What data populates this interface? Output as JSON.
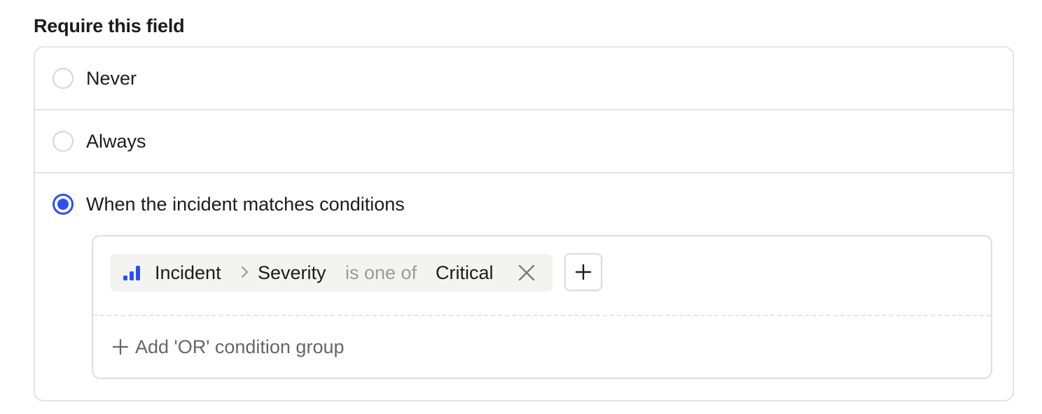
{
  "field": {
    "label": "Require this field"
  },
  "options": [
    {
      "label": "Never",
      "selected": false
    },
    {
      "label": "Always",
      "selected": false
    },
    {
      "label": "When the incident matches conditions",
      "selected": true
    }
  ],
  "conditions": {
    "groups": [
      {
        "conditions": [
          {
            "entity": "Incident",
            "field": "Severity",
            "operator": "is one of",
            "value": "Critical",
            "icon": "severity-bars-icon"
          }
        ]
      }
    ],
    "add_or_label": "Add 'OR' condition group"
  },
  "colors": {
    "accent": "#2e4ff0",
    "border": "#e3e3e3",
    "chip_bg": "#f3f3f2",
    "muted_text": "#9b9b9b"
  }
}
